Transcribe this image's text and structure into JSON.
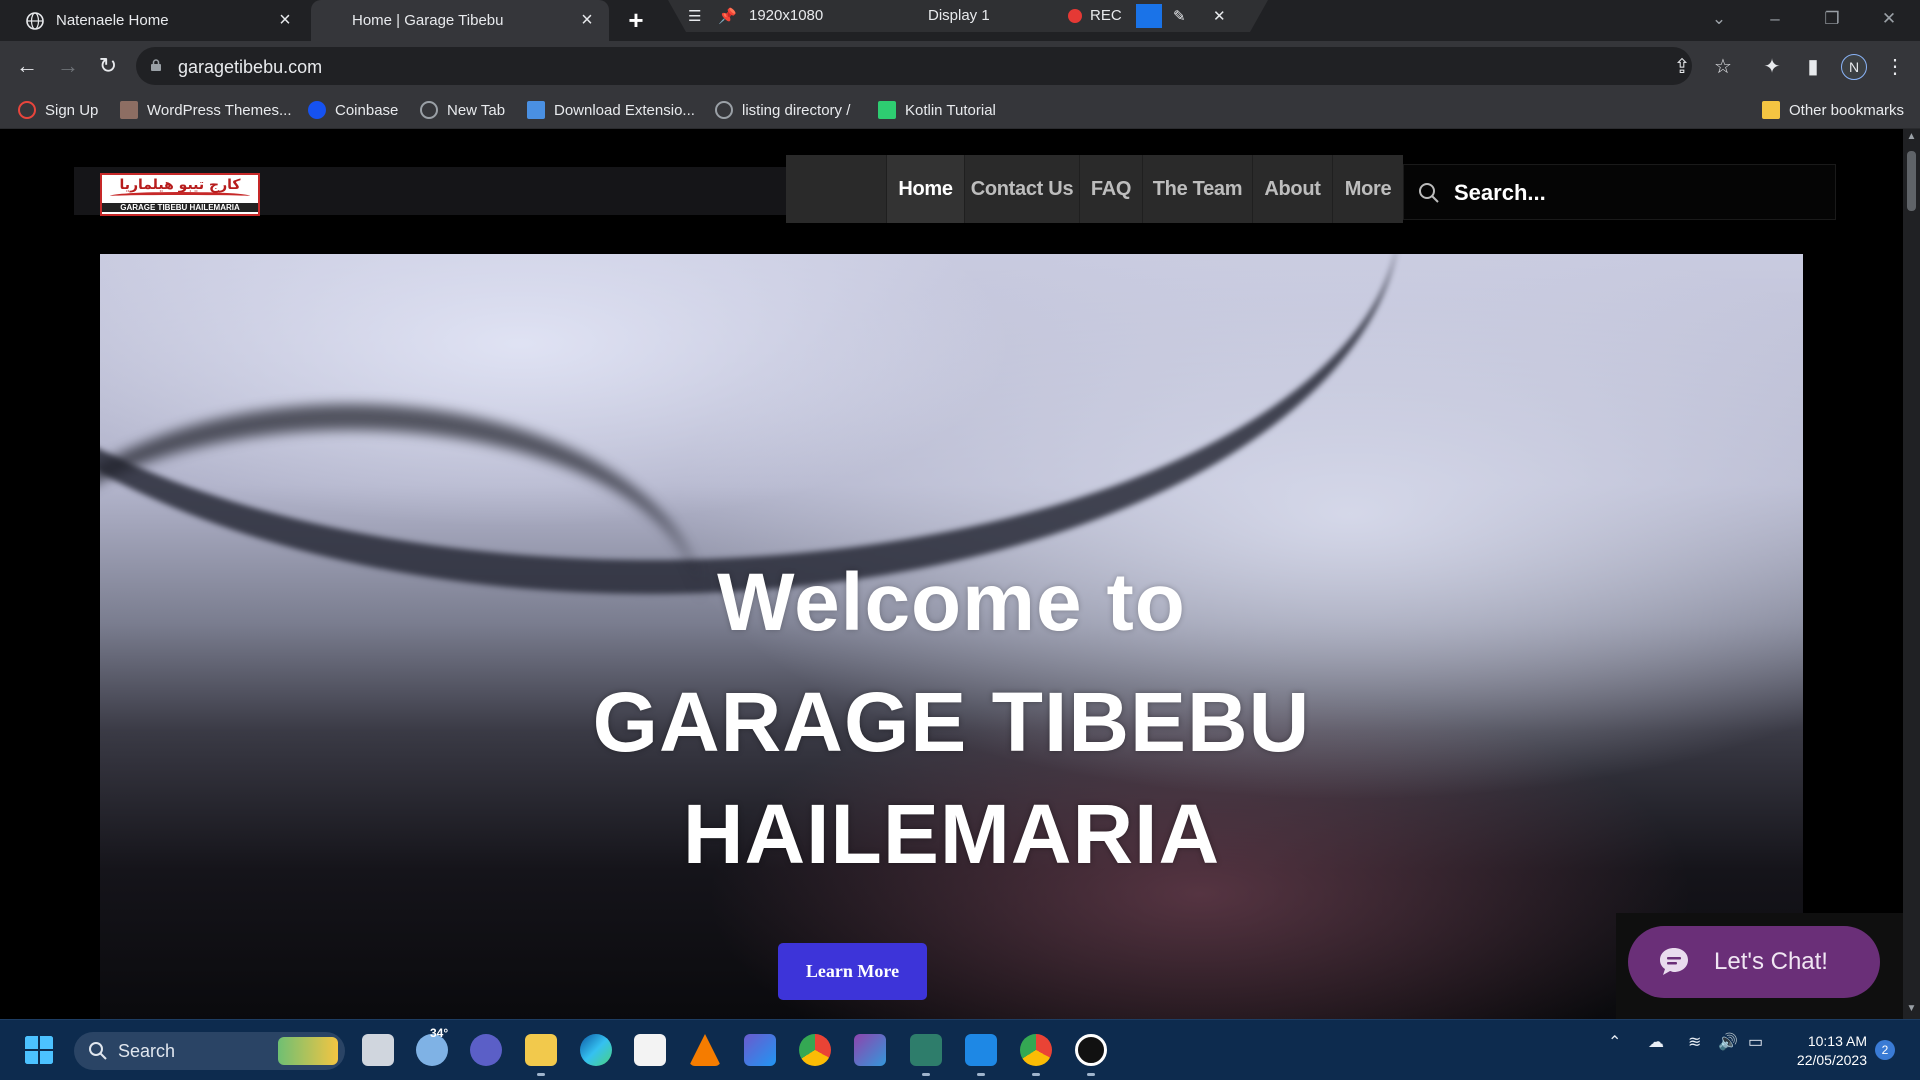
{
  "browser": {
    "tabs": [
      {
        "title": "Natenaele Home",
        "active": false
      },
      {
        "title": "Home | Garage Tibebu",
        "active": true
      }
    ],
    "new_tab_label": "+",
    "recorder": {
      "menu_icon": "hamburger-icon",
      "resolution": "1920x1080",
      "display": "Display 1",
      "rec_label": "REC"
    },
    "url": "garagetibebu.com",
    "profile_initial": "N",
    "bookmarks": [
      {
        "label": "Sign Up",
        "color": "#e8453c"
      },
      {
        "label": "WordPress Themes...",
        "color": "#8d6e63"
      },
      {
        "label": "Coinbase",
        "color": "#1652f0"
      },
      {
        "label": "New Tab",
        "color": "#9aa0a6"
      },
      {
        "label": "Download Extensio...",
        "color": "#4a90e2"
      },
      {
        "label": "listing directory /",
        "color": "#9aa0a6"
      },
      {
        "label": "Kotlin Tutorial",
        "color": "#2ecc71"
      }
    ],
    "other_bookmarks": "Other bookmarks"
  },
  "site": {
    "logo": {
      "arabic": "كارج تيبو هيلماريا",
      "english": "GARAGE TIBEBU HAILEMARIA"
    },
    "nav": [
      {
        "label": "Home",
        "active": true
      },
      {
        "label": "Contact Us",
        "active": false
      },
      {
        "label": "FAQ",
        "active": false
      },
      {
        "label": "The Team",
        "active": false
      },
      {
        "label": "About",
        "active": false
      },
      {
        "label": "More",
        "active": false
      }
    ],
    "search_placeholder": "Search...",
    "hero": {
      "welcome": "Welcome to",
      "title_line1": "GARAGE TIBEBU",
      "title_line2": "HAILEMARIA",
      "button": "Learn More"
    },
    "chat_label": "Let's Chat!",
    "colors": {
      "accent_button": "#3d34d9",
      "chat_button": "#6a2f78"
    }
  },
  "taskbar": {
    "search_label": "Search",
    "weather_temp": "34°",
    "time": "10:13 AM",
    "date": "22/05/2023",
    "notification_count": "2"
  }
}
